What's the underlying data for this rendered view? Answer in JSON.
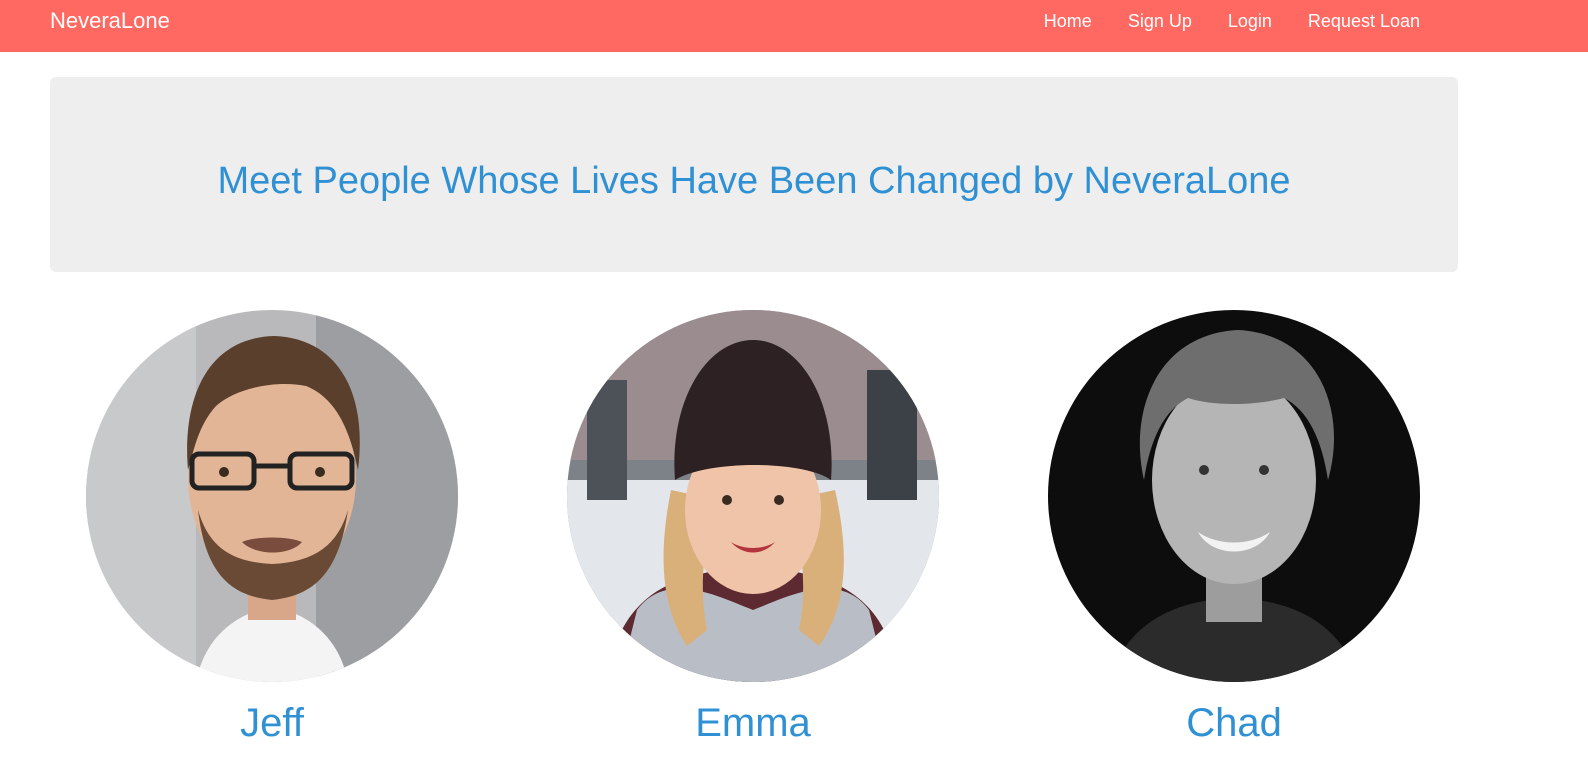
{
  "nav": {
    "brand": "NeveraLone",
    "links": [
      "Home",
      "Sign Up",
      "Login",
      "Request Loan"
    ],
    "background_color": "#ff6961"
  },
  "hero": {
    "title": "Meet People Whose Lives Have Been Changed by NeveraLone",
    "title_color": "#3090d4",
    "background_color": "#eeeeee"
  },
  "people": [
    {
      "name": "Jeff",
      "photo": "portrait-man-glasses"
    },
    {
      "name": "Emma",
      "photo": "portrait-woman-beanie"
    },
    {
      "name": "Chad",
      "photo": "portrait-man-curly-hair-bw"
    }
  ]
}
